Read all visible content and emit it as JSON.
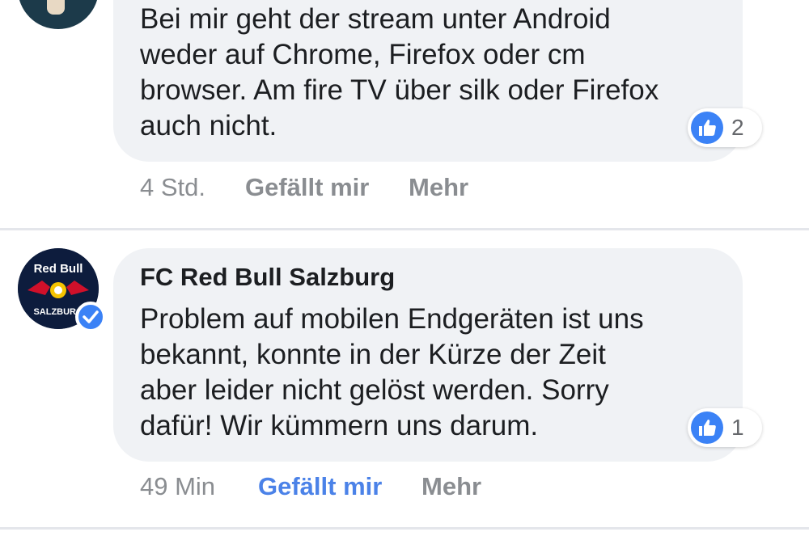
{
  "comments": [
    {
      "text": "Bei mir geht der stream unter Android\nweder auf Chrome, Firefox oder cm\nbrowser. Am fire TV über silk oder Firefox\nauch nicht.",
      "reaction_count": "2",
      "time": "4 Std.",
      "like_label": "Gefällt mir",
      "more_label": "Mehr"
    },
    {
      "author": "FC Red Bull Salzburg",
      "logo_text": "Red Bull",
      "logo_subtext": "SALZBURG",
      "text": "Problem auf mobilen Endgeräten ist uns\nbekannt, konnte in der Kürze der Zeit\naber leider nicht gelöst werden. Sorry\ndafür! Wir kümmern uns darum.",
      "reaction_count": "1",
      "time": "49 Min",
      "like_label": "Gefällt mir",
      "more_label": "Mehr",
      "like_active_color": "#4b82e8"
    }
  ],
  "colors": {
    "bubble_bg": "#f0f2f5",
    "like_blue": "#3b82f6",
    "meta_gray": "#8a8d91"
  }
}
